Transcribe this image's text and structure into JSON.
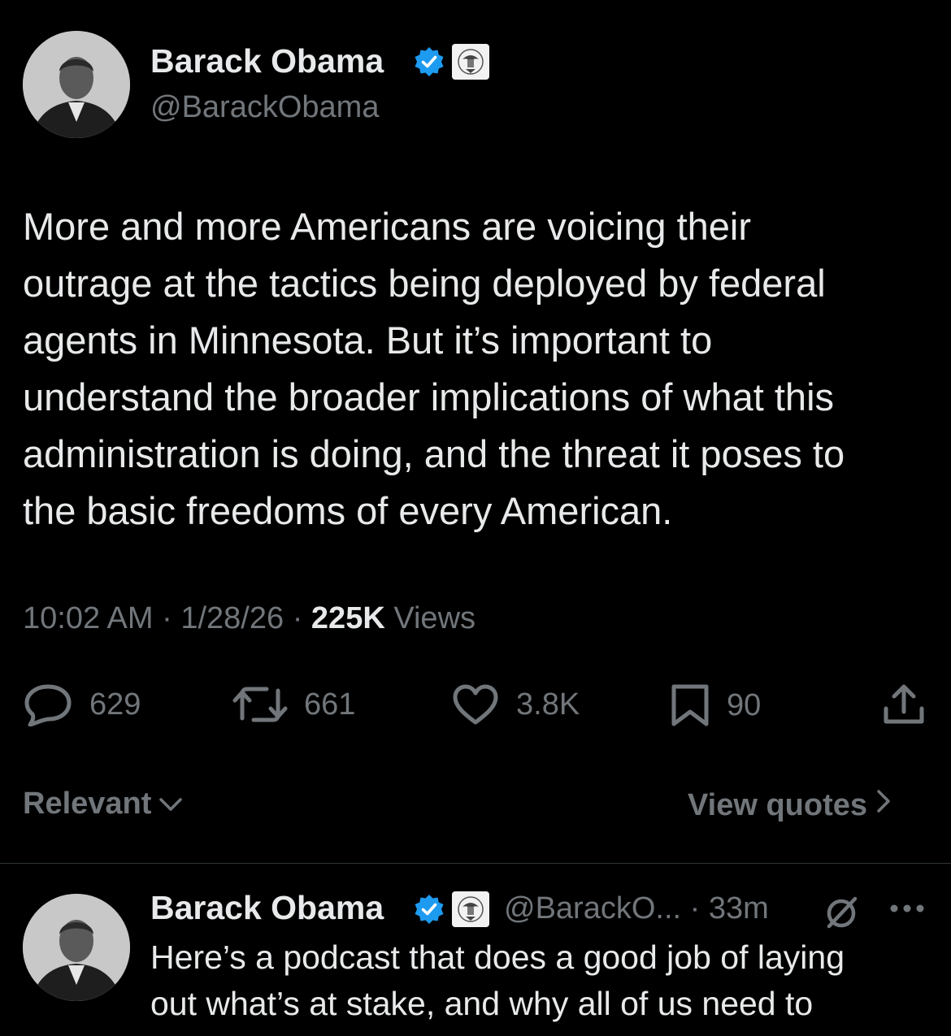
{
  "tweet": {
    "author": {
      "name": "Barack Obama",
      "handle": "@BarackObama",
      "avatar_icon": "avatar-photo"
    },
    "badges": {
      "verified_icon": "verified-badge-icon",
      "affiliation_icon": "government-seal-icon",
      "verified_color": "#1d9bf0"
    },
    "text": "More and more Americans are voicing their\noutrage at the tactics being deployed by federal\nagents in Minnesota. But it’s important to\nunderstand the broader implications of what this\nadministration is doing, and the threat it poses to\nthe basic freedoms of every American.",
    "time": "10:02 AM",
    "separator": "·",
    "date": "1/28/26",
    "views_count": "225K",
    "views_label": "Views",
    "actions": {
      "replies": "629",
      "reposts": "661",
      "likes": "3.8K",
      "bookmarks": "90"
    }
  },
  "filters": {
    "sort_label": "Relevant",
    "quotes_label": "View quotes"
  },
  "reply": {
    "author": {
      "name": "Barack Obama",
      "handle": "@BarackO...",
      "separator": "·",
      "time": "33m"
    },
    "text": "Here’s a podcast that does a good job of laying\nout what’s at stake, and why all of us need to"
  },
  "colors": {
    "background": "#000000",
    "primary_text": "#e7e9ea",
    "secondary_text": "#71767b",
    "accent_blue": "#1d9bf0",
    "divider": "#2f3336"
  }
}
